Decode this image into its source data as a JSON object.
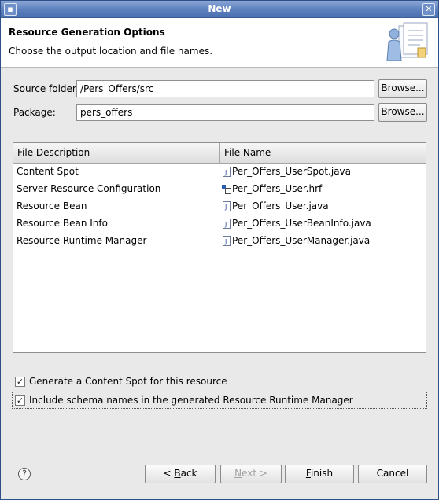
{
  "window": {
    "title": "New",
    "menu_glyph": "▪",
    "close_glyph": "✕"
  },
  "header": {
    "title": "Resource Generation Options",
    "description": "Choose the output location and file names.",
    "icon": "wizard-banner-icon"
  },
  "form": {
    "source_folder_label": "Source folder:",
    "source_folder_value": "/Pers_Offers/src",
    "package_label": "Package:",
    "package_value": "pers_offers",
    "browse_label": "Browse..."
  },
  "table": {
    "columns": [
      "File Description",
      "File Name"
    ],
    "rows": [
      {
        "description": "Content Spot",
        "file": "Per_Offers_UserSpot.java",
        "icon": "java-file-icon"
      },
      {
        "description": "Server Resource Configuration",
        "file": "Per_Offers_User.hrf",
        "icon": "hrf-file-icon"
      },
      {
        "description": "Resource Bean",
        "file": "Per_Offers_User.java",
        "icon": "java-file-icon"
      },
      {
        "description": "Resource Bean Info",
        "file": "Per_Offers_UserBeanInfo.java",
        "icon": "java-file-icon"
      },
      {
        "description": "Resource Runtime Manager",
        "file": "Per_Offers_UserManager.java",
        "icon": "java-file-icon"
      }
    ]
  },
  "options": {
    "generate_content_spot": {
      "label": "Generate a Content Spot for this resource",
      "checked": true
    },
    "include_schema_names": {
      "label": "Include schema names in the generated Resource Runtime Manager",
      "checked": true
    }
  },
  "footer": {
    "help_glyph": "?",
    "back_mnemonic": "B",
    "back_rest": "ack",
    "back_prefix": "< ",
    "next_prefix": "N",
    "next_rest": "ext >",
    "finish_mnemonic": "F",
    "finish_rest": "inish",
    "cancel_label": "Cancel"
  },
  "colors": {
    "titlebar": "#5f82bf",
    "dialog_bg": "#e9e9e9",
    "header_bg": "#ffffff"
  }
}
